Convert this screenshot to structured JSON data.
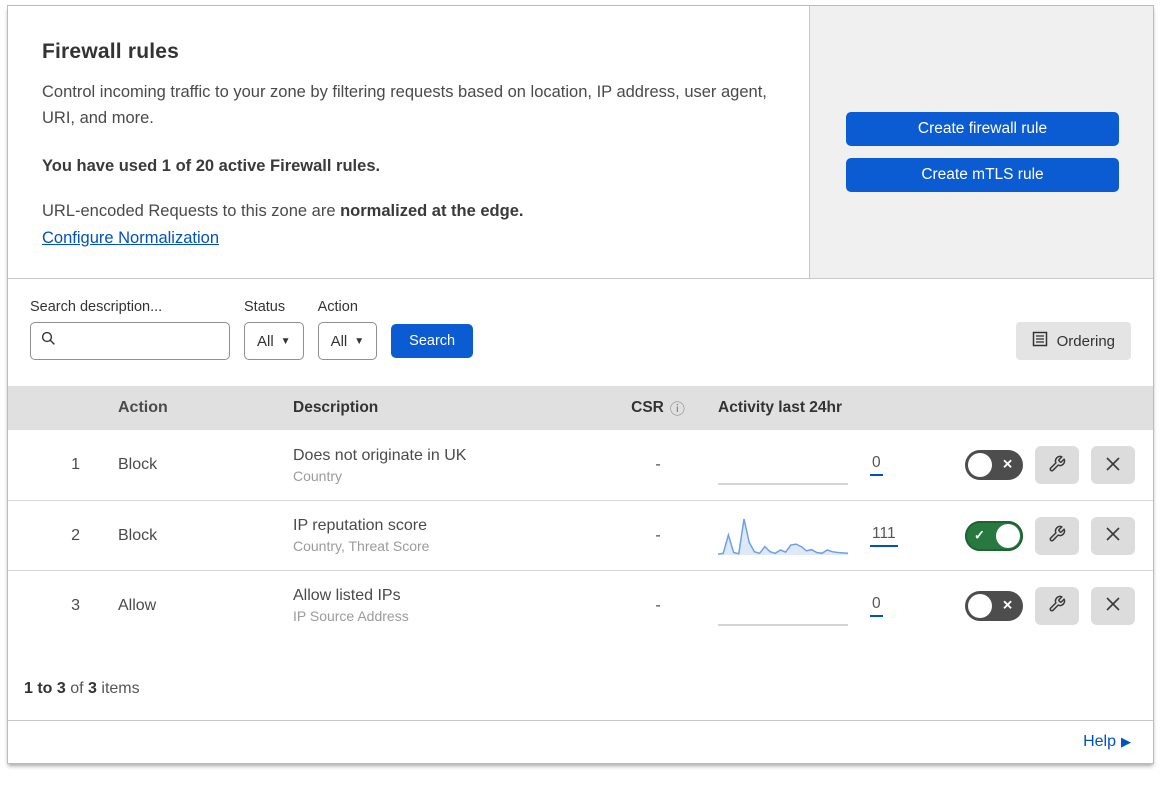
{
  "header": {
    "title": "Firewall rules",
    "description": "Control incoming traffic to your zone by filtering requests based on location, IP address, user agent, URI, and more.",
    "usage": "You have used 1 of 20 active Firewall rules.",
    "normalization_prefix": "URL-encoded Requests to this zone are ",
    "normalization_bold": "normalized at the edge.",
    "normalization_link": "Configure Normalization",
    "create_firewall_button": "Create firewall rule",
    "create_mtls_button": "Create mTLS rule"
  },
  "filters": {
    "search_label": "Search description...",
    "search_value": "",
    "status_label": "Status",
    "status_value": "All",
    "action_label": "Action",
    "action_value": "All",
    "search_button": "Search",
    "ordering_button": "Ordering"
  },
  "table": {
    "headers": {
      "action": "Action",
      "description": "Description",
      "csr": "CSR",
      "activity": "Activity last 24hr"
    },
    "rows": [
      {
        "num": "1",
        "action": "Block",
        "description": "Does not originate in UK",
        "criteria": "Country",
        "csr": "-",
        "activity_count": "0",
        "enabled": false,
        "sparkline": []
      },
      {
        "num": "2",
        "action": "Block",
        "description": "IP reputation score",
        "criteria": "Country, Threat Score",
        "csr": "-",
        "activity_count": "111",
        "enabled": true,
        "sparkline": [
          2,
          4,
          48,
          6,
          3,
          86,
          30,
          8,
          4,
          20,
          8,
          4,
          12,
          7,
          24,
          26,
          20,
          10,
          13,
          6,
          4,
          12,
          8,
          6,
          5,
          4
        ]
      },
      {
        "num": "3",
        "action": "Allow",
        "description": "Allow listed IPs",
        "criteria": "IP Source Address",
        "csr": "-",
        "activity_count": "0",
        "enabled": false,
        "sparkline": []
      }
    ]
  },
  "footer": {
    "count_range": "1 to 3",
    "count_of": " of ",
    "count_total": "3",
    "count_items": " items",
    "help_link": "Help"
  },
  "colors": {
    "primary_blue": "#0b5bd3",
    "link_blue": "#0051c3",
    "toggle_on_green": "#28793f",
    "toggle_off_gray": "#4d4d4d",
    "sparkline_blue": "#6f9fe6",
    "sparkline_fill": "#dde8f8",
    "flat_line_gray": "#c5c5c5"
  }
}
